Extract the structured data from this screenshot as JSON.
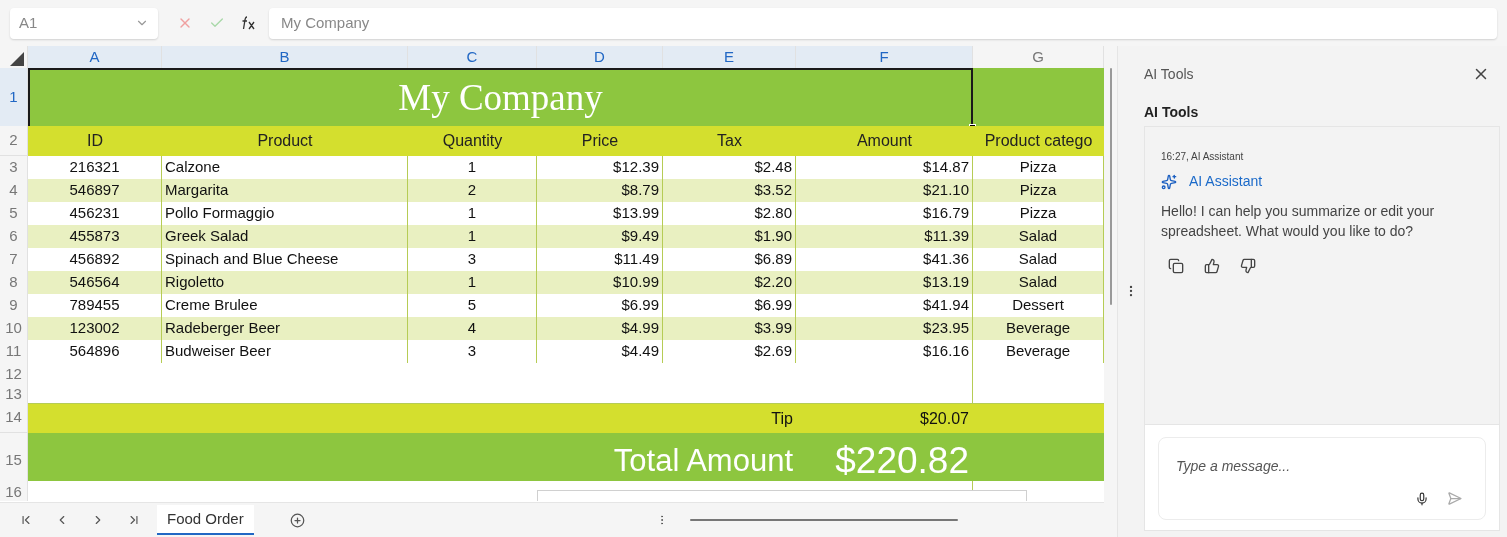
{
  "formula_bar": {
    "name_box": "A1",
    "formula": "My Company"
  },
  "columns": [
    {
      "label": "A",
      "selected": true
    },
    {
      "label": "B",
      "selected": true
    },
    {
      "label": "C",
      "selected": true
    },
    {
      "label": "D",
      "selected": true
    },
    {
      "label": "E",
      "selected": true
    },
    {
      "label": "F",
      "selected": true
    },
    {
      "label": "G",
      "selected": false
    }
  ],
  "rows": [
    {
      "number": "1",
      "kind": "title",
      "selected": true,
      "cells": [
        "My Company"
      ]
    },
    {
      "number": "2",
      "kind": "header",
      "selected": false,
      "cells": [
        "ID",
        "Product",
        "Quantity",
        "Price",
        "Tax",
        "Amount",
        "Product catego"
      ]
    },
    {
      "number": "3",
      "kind": "data",
      "selected": false,
      "cells": [
        "216321",
        "Calzone",
        "1",
        "$12.39",
        "$2.48",
        "$14.87",
        "Pizza"
      ]
    },
    {
      "number": "4",
      "kind": "data",
      "selected": false,
      "cells": [
        "546897",
        "Margarita",
        "2",
        "$8.79",
        "$3.52",
        "$21.10",
        "Pizza"
      ]
    },
    {
      "number": "5",
      "kind": "data",
      "selected": false,
      "cells": [
        "456231",
        "Pollo Formaggio",
        "1",
        "$13.99",
        "$2.80",
        "$16.79",
        "Pizza"
      ]
    },
    {
      "number": "6",
      "kind": "data",
      "selected": false,
      "cells": [
        "455873",
        "Greek Salad",
        "1",
        "$9.49",
        "$1.90",
        "$11.39",
        "Salad"
      ]
    },
    {
      "number": "7",
      "kind": "data",
      "selected": false,
      "cells": [
        "456892",
        "Spinach and Blue Cheese",
        "3",
        "$11.49",
        "$6.89",
        "$41.36",
        "Salad"
      ]
    },
    {
      "number": "8",
      "kind": "data",
      "selected": false,
      "cells": [
        "546564",
        "Rigoletto",
        "1",
        "$10.99",
        "$2.20",
        "$13.19",
        "Salad"
      ]
    },
    {
      "number": "9",
      "kind": "data",
      "selected": false,
      "cells": [
        "789455",
        "Creme Brulee",
        "5",
        "$6.99",
        "$6.99",
        "$41.94",
        "Dessert"
      ]
    },
    {
      "number": "10",
      "kind": "data",
      "selected": false,
      "cells": [
        "123002",
        "Radeberger Beer",
        "4",
        "$4.99",
        "$3.99",
        "$23.95",
        "Beverage"
      ]
    },
    {
      "number": "11",
      "kind": "data",
      "selected": false,
      "cells": [
        "564896",
        "Budweiser Beer",
        "3",
        "$4.49",
        "$2.69",
        "$16.16",
        "Beverage"
      ]
    },
    {
      "number": "12",
      "kind": "blank",
      "selected": false,
      "cells": []
    },
    {
      "number": "13",
      "kind": "blank",
      "selected": false,
      "cells": []
    },
    {
      "number": "14",
      "kind": "tip",
      "selected": false,
      "cells": [
        "Tip",
        "$20.07"
      ]
    },
    {
      "number": "15",
      "kind": "total",
      "selected": false,
      "cells": [
        "Total Amount",
        "$220.82"
      ]
    },
    {
      "number": "16",
      "kind": "chart",
      "selected": false,
      "cells": []
    }
  ],
  "sheet_tabs": [
    {
      "label": "Food Order",
      "selected": true
    }
  ],
  "panel": {
    "title": "AI Tools",
    "heading": "AI Tools",
    "message": {
      "meta": "16:27, AI Assistant",
      "sender": "AI Assistant",
      "text": "Hello! I can help you summarize or edit your spreadsheet. What would you like to do?"
    },
    "input": {
      "placeholder": "Type a message..."
    }
  }
}
